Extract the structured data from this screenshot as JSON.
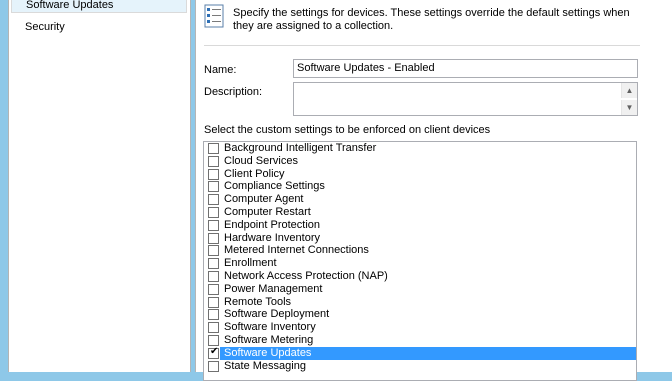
{
  "navigation": {
    "items": [
      {
        "label": "Software Updates",
        "selected": true
      },
      {
        "label": "Security",
        "selected": false
      }
    ]
  },
  "header": {
    "icon": "settings-list-icon",
    "description": "Specify the settings for devices. These settings override the default settings when they are assigned to a collection."
  },
  "form": {
    "name_label": "Name:",
    "name_value": "Software Updates - Enabled",
    "description_label": "Description:",
    "description_value": "",
    "custom_settings_label": "Select the custom settings to be enforced on client devices"
  },
  "settings_list": {
    "items": [
      {
        "label": "Background Intelligent Transfer",
        "checked": false,
        "selected": false
      },
      {
        "label": "Cloud Services",
        "checked": false,
        "selected": false
      },
      {
        "label": "Client Policy",
        "checked": false,
        "selected": false
      },
      {
        "label": "Compliance Settings",
        "checked": false,
        "selected": false
      },
      {
        "label": "Computer Agent",
        "checked": false,
        "selected": false
      },
      {
        "label": "Computer Restart",
        "checked": false,
        "selected": false
      },
      {
        "label": "Endpoint Protection",
        "checked": false,
        "selected": false
      },
      {
        "label": "Hardware Inventory",
        "checked": false,
        "selected": false
      },
      {
        "label": "Metered Internet Connections",
        "checked": false,
        "selected": false
      },
      {
        "label": "Enrollment",
        "checked": false,
        "selected": false
      },
      {
        "label": "Network Access Protection (NAP)",
        "checked": false,
        "selected": false
      },
      {
        "label": "Power Management",
        "checked": false,
        "selected": false
      },
      {
        "label": "Remote Tools",
        "checked": false,
        "selected": false
      },
      {
        "label": "Software Deployment",
        "checked": false,
        "selected": false
      },
      {
        "label": "Software Inventory",
        "checked": false,
        "selected": false
      },
      {
        "label": "Software Metering",
        "checked": false,
        "selected": false
      },
      {
        "label": "Software Updates",
        "checked": true,
        "selected": true
      },
      {
        "label": "State Messaging",
        "checked": false,
        "selected": false
      }
    ]
  },
  "colors": {
    "selection": "#3399ff",
    "nav_selected": "#e5f3fb",
    "background": "#8ec8e8"
  }
}
